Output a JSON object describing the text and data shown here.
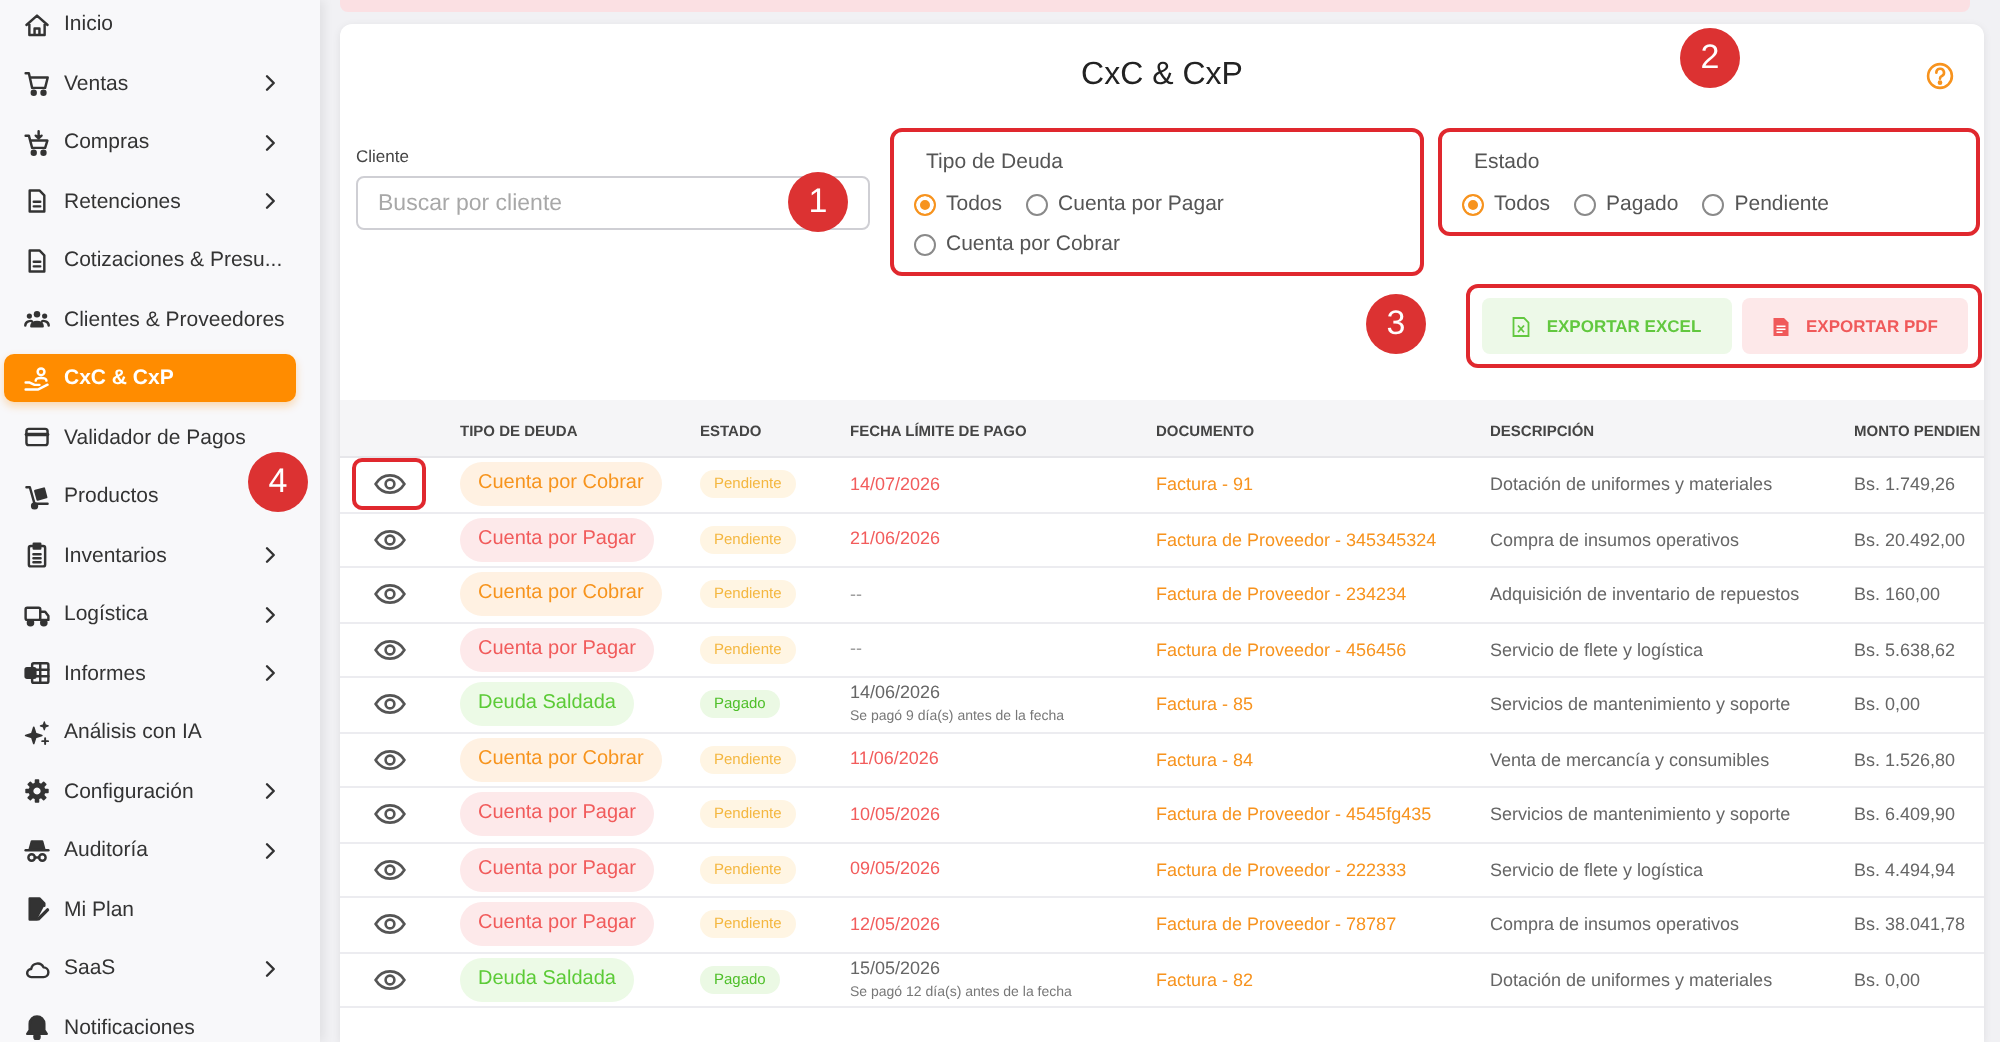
{
  "sidebar": {
    "items": [
      {
        "label": "Inicio",
        "has_submenu": false,
        "selected": false
      },
      {
        "label": "Ventas",
        "has_submenu": true,
        "selected": false
      },
      {
        "label": "Compras",
        "has_submenu": true,
        "selected": false
      },
      {
        "label": "Retenciones",
        "has_submenu": true,
        "selected": false
      },
      {
        "label": "Cotizaciones & Presu...",
        "has_submenu": false,
        "selected": false
      },
      {
        "label": "Clientes & Proveedores",
        "has_submenu": false,
        "selected": false
      },
      {
        "label": "CxC & CxP",
        "has_submenu": false,
        "selected": true
      },
      {
        "label": "Validador de Pagos",
        "has_submenu": false,
        "selected": false
      },
      {
        "label": "Productos",
        "has_submenu": false,
        "selected": false
      },
      {
        "label": "Inventarios",
        "has_submenu": true,
        "selected": false
      },
      {
        "label": "Logística",
        "has_submenu": true,
        "selected": false
      },
      {
        "label": "Informes",
        "has_submenu": true,
        "selected": false
      },
      {
        "label": "Análisis con IA",
        "has_submenu": false,
        "selected": false
      },
      {
        "label": "Configuración",
        "has_submenu": true,
        "selected": false
      },
      {
        "label": "Auditoría",
        "has_submenu": true,
        "selected": false
      },
      {
        "label": "Mi Plan",
        "has_submenu": false,
        "selected": false
      },
      {
        "label": "SaaS",
        "has_submenu": true,
        "selected": false
      },
      {
        "label": "Notificaciones",
        "has_submenu": false,
        "selected": false
      }
    ]
  },
  "page": {
    "title": "CxC & CxP"
  },
  "filters": {
    "client": {
      "label": "Cliente",
      "placeholder": "Buscar por cliente"
    },
    "debt_type": {
      "label": "Tipo de Deuda",
      "highlighted": true,
      "options": [
        {
          "label": "Todos",
          "selected": true
        },
        {
          "label": "Cuenta por Pagar",
          "selected": false
        },
        {
          "label": "Cuenta por Cobrar",
          "selected": false
        }
      ]
    },
    "status": {
      "label": "Estado",
      "highlighted": true,
      "options": [
        {
          "label": "Todos",
          "selected": true
        },
        {
          "label": "Pagado",
          "selected": false
        },
        {
          "label": "Pendiente",
          "selected": false
        }
      ]
    }
  },
  "export": {
    "highlighted": true,
    "buttons": [
      {
        "label": "EXPORTAR EXCEL",
        "kind": "excel"
      },
      {
        "label": "EXPORTAR PDF",
        "kind": "pdf"
      }
    ]
  },
  "table": {
    "columns": [
      "TIPO DE DEUDA",
      "ESTADO",
      "FECHA LÍMITE DE PAGO",
      "DOCUMENTO",
      "DESCRIPCIÓN",
      "MONTO PENDIEN"
    ],
    "rows": [
      {
        "highlighted": true,
        "type": {
          "text": "Cuenta por Cobrar",
          "kind": "receivable"
        },
        "status": {
          "text": "Pendiente",
          "kind": "pending"
        },
        "due": {
          "text": "14/07/2026",
          "kind": "pending"
        },
        "document": "Factura - 91",
        "description": "Dotación de uniformes y materiales",
        "amount": "Bs. 1.749,26"
      },
      {
        "highlighted": false,
        "type": {
          "text": "Cuenta por Pagar",
          "kind": "payable"
        },
        "status": {
          "text": "Pendiente",
          "kind": "pending"
        },
        "due": {
          "text": "21/06/2026",
          "kind": "pending"
        },
        "document": "Factura de Proveedor - 345345324",
        "description": "Compra de insumos operativos",
        "amount": "Bs. 20.492,00"
      },
      {
        "highlighted": false,
        "type": {
          "text": "Cuenta por Cobrar",
          "kind": "receivable"
        },
        "status": {
          "text": "Pendiente",
          "kind": "pending"
        },
        "due": {
          "text": "--",
          "kind": "empty"
        },
        "document": "Factura de Proveedor - 234234",
        "description": "Adquisición de inventario de repuestos",
        "amount": "Bs. 160,00"
      },
      {
        "highlighted": false,
        "type": {
          "text": "Cuenta por Pagar",
          "kind": "payable"
        },
        "status": {
          "text": "Pendiente",
          "kind": "pending"
        },
        "due": {
          "text": "--",
          "kind": "empty"
        },
        "document": "Factura de Proveedor - 456456",
        "description": "Servicio de flete y logística",
        "amount": "Bs. 5.638,62"
      },
      {
        "highlighted": false,
        "type": {
          "text": "Deuda Saldada",
          "kind": "settled"
        },
        "status": {
          "text": "Pagado",
          "kind": "paid"
        },
        "due": {
          "text": "14/06/2026",
          "kind": "paid",
          "note": "Se pagó 9 día(s) antes de la fecha"
        },
        "document": "Factura - 85",
        "description": "Servicios de mantenimiento y soporte",
        "amount": "Bs. 0,00"
      },
      {
        "highlighted": false,
        "type": {
          "text": "Cuenta por Cobrar",
          "kind": "receivable"
        },
        "status": {
          "text": "Pendiente",
          "kind": "pending"
        },
        "due": {
          "text": "11/06/2026",
          "kind": "pending"
        },
        "document": "Factura - 84",
        "description": "Venta de mercancía y consumibles",
        "amount": "Bs. 1.526,80"
      },
      {
        "highlighted": false,
        "type": {
          "text": "Cuenta por Pagar",
          "kind": "payable"
        },
        "status": {
          "text": "Pendiente",
          "kind": "pending"
        },
        "due": {
          "text": "10/05/2026",
          "kind": "pending"
        },
        "document": "Factura de Proveedor - 4545fg435",
        "description": "Servicios de mantenimiento y soporte",
        "amount": "Bs. 6.409,90"
      },
      {
        "highlighted": false,
        "type": {
          "text": "Cuenta por Pagar",
          "kind": "payable"
        },
        "status": {
          "text": "Pendiente",
          "kind": "pending"
        },
        "due": {
          "text": "09/05/2026",
          "kind": "pending"
        },
        "document": "Factura de Proveedor - 222333",
        "description": "Servicio de flete y logística",
        "amount": "Bs. 4.494,94"
      },
      {
        "highlighted": false,
        "type": {
          "text": "Cuenta por Pagar",
          "kind": "payable"
        },
        "status": {
          "text": "Pendiente",
          "kind": "pending"
        },
        "due": {
          "text": "12/05/2026",
          "kind": "pending"
        },
        "document": "Factura de Proveedor - 78787",
        "description": "Compra de insumos operativos",
        "amount": "Bs. 38.041,78"
      },
      {
        "highlighted": false,
        "type": {
          "text": "Deuda Saldada",
          "kind": "settled"
        },
        "status": {
          "text": "Pagado",
          "kind": "paid"
        },
        "due": {
          "text": "15/05/2026",
          "kind": "paid",
          "note": "Se pagó 12 día(s) antes de la fecha"
        },
        "document": "Factura - 82",
        "description": "Dotación de uniformes y materiales",
        "amount": "Bs. 0,00"
      }
    ]
  },
  "annotations": [
    {
      "label": "1"
    },
    {
      "label": "2"
    },
    {
      "label": "3"
    },
    {
      "label": "4"
    }
  ]
}
